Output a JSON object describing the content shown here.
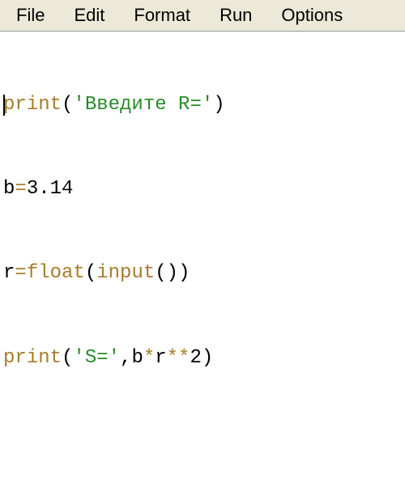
{
  "menubar": {
    "items": [
      "File",
      "Edit",
      "Format",
      "Run",
      "Options"
    ]
  },
  "code": {
    "line1": {
      "fn": "print",
      "paren_open": "(",
      "str": "'Введите R='",
      "paren_close": ")"
    },
    "line2": {
      "var": "b",
      "eq": "=",
      "num": "3.14"
    },
    "line3": {
      "var": "r",
      "eq": "=",
      "fn1": "float",
      "p1o": "(",
      "fn2": "input",
      "p2o": "(",
      "p2c": ")",
      "p1c": ")"
    },
    "line4": {
      "fn": "print",
      "paren_open": "(",
      "str": "'S='",
      "comma": ",",
      "expr1": "b",
      "op1": "*",
      "expr2": "r",
      "op2": "**",
      "expr3": "2",
      "paren_close": ")"
    }
  }
}
